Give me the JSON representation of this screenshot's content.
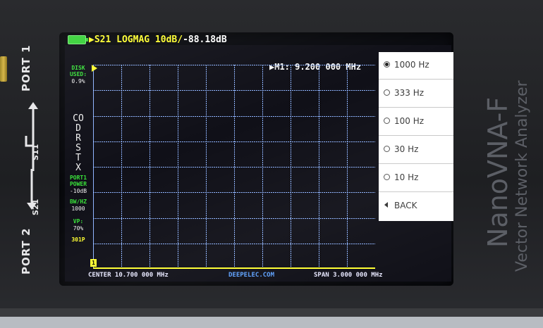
{
  "device": {
    "port1": "PORT 1",
    "port2": "PORT 2",
    "s11": "S11",
    "s21": "S21",
    "brand": "NanoVNA-F",
    "subtitle": "Vector Network Analyzer"
  },
  "header": {
    "trace_title": "S21 LOGMAG 10dB/",
    "trace_value": "-88.18dB",
    "marker": "M1: 9.200 000 MHz"
  },
  "left_panel": {
    "disk": "DISK",
    "used": "USED:",
    "used_value": "0.9%",
    "cal_letters": "CO\nD\nR\nS\nT\nX",
    "port_power": "PORT1",
    "power_label": "POWER",
    "power_value": "-10dB",
    "bw_label": "BW/HZ",
    "bw_value": "1000",
    "vp_label": "VP:",
    "vp_value": "70%",
    "points": "301P"
  },
  "footer": {
    "center": "CENTER 10.700 000 MHz",
    "website": "DEEPELEC.COM",
    "span": "SPAN 3.000 000 MHz"
  },
  "menu": {
    "items": [
      {
        "label": "1000 Hz",
        "selected": true
      },
      {
        "label": "333 Hz",
        "selected": false
      },
      {
        "label": "100 Hz",
        "selected": false
      },
      {
        "label": "30 Hz",
        "selected": false
      },
      {
        "label": "10 Hz",
        "selected": false
      }
    ],
    "back": "BACK"
  },
  "colors": {
    "grid": "#8fb4ff",
    "trace_yellow": "#ffff30",
    "status_green": "#39e03a"
  },
  "scale_marker": "1"
}
